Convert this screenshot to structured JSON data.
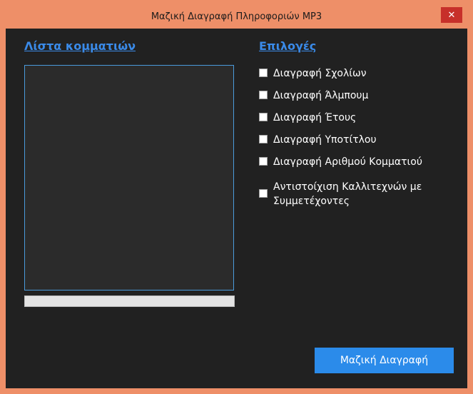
{
  "window": {
    "title": "Μαζική Διαγραφή Πληροφοριών MP3",
    "close_glyph": "✕"
  },
  "tracks": {
    "heading": "Λίστα κομματιών",
    "items": []
  },
  "progress": {
    "fraction": 0
  },
  "options": {
    "heading": "Επιλογές",
    "items": [
      {
        "label": "Διαγραφή Σχολίων",
        "checked": false
      },
      {
        "label": "Διαγραφή Άλμπουμ",
        "checked": false
      },
      {
        "label": "Διαγραφή Έτους",
        "checked": false
      },
      {
        "label": "Διαγραφή Υποτίτλου",
        "checked": false
      },
      {
        "label": "Διαγραφή Αριθμού Κομματιού",
        "checked": false
      },
      {
        "label": "Αντιστοίχιση Καλλιτεχνών με Συμμετέχοντες",
        "checked": false
      }
    ]
  },
  "actions": {
    "mass_delete_label": "Μαζική Διαγραφή"
  },
  "colors": {
    "accent": "#3a8ae8",
    "button": "#2b8bea",
    "window_frame": "#ee8f68",
    "client_bg": "#212121"
  }
}
